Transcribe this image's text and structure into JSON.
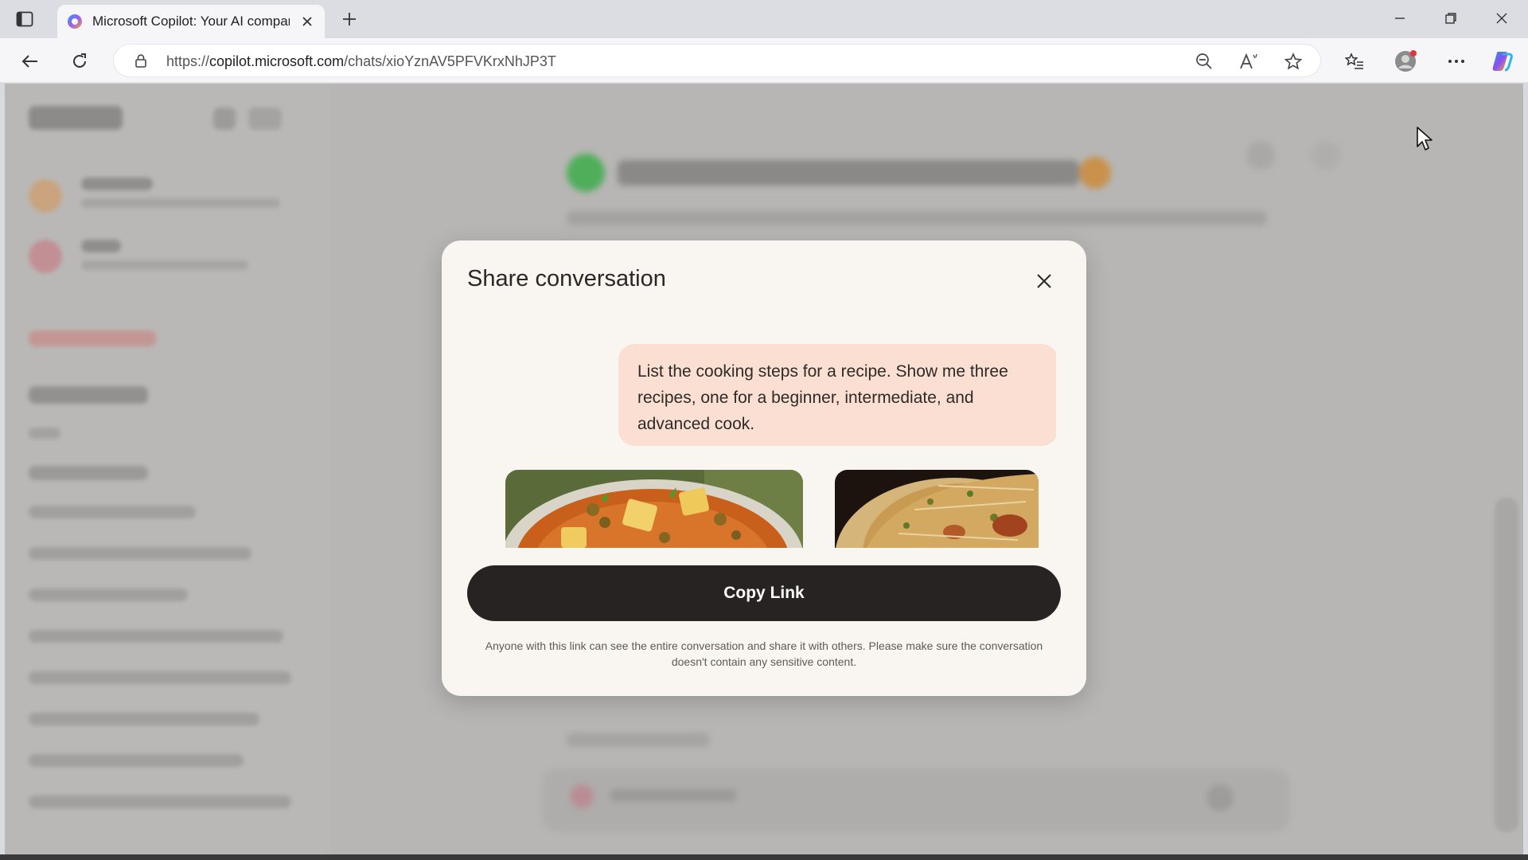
{
  "browser": {
    "tab_title": "Microsoft Copilot: Your AI companion",
    "url_prefix": "https://",
    "url_host": "copilot.microsoft.com",
    "url_path": "/chats/xioYznAV5PFVKrxNhJP3T",
    "icons": [
      "tab-actions-icon",
      "copilot-favicon",
      "close-icon",
      "plus-icon",
      "minimize-icon",
      "restore-icon",
      "close-window-icon",
      "back-icon",
      "refresh-icon",
      "lock-icon",
      "zoom-out-icon",
      "read-aloud-icon",
      "favorite-star-icon",
      "favorites-list-icon",
      "profile-icon",
      "more-icon",
      "copilot-icon"
    ]
  },
  "dialog": {
    "title": "Share conversation",
    "user_message": "List the cooking steps for a recipe. Show me three recipes, one for a beginner, intermediate, and advanced cook.",
    "copy_button": "Copy Link",
    "disclaimer": "Anyone with this link can see the entire conversation and share it with others. Please make sure the conversation doesn't contain any sensitive content."
  },
  "colors": {
    "accent_bubble": "#fbdfd2",
    "button_dark": "#262322",
    "dialog_bg": "#f9f6f2"
  }
}
